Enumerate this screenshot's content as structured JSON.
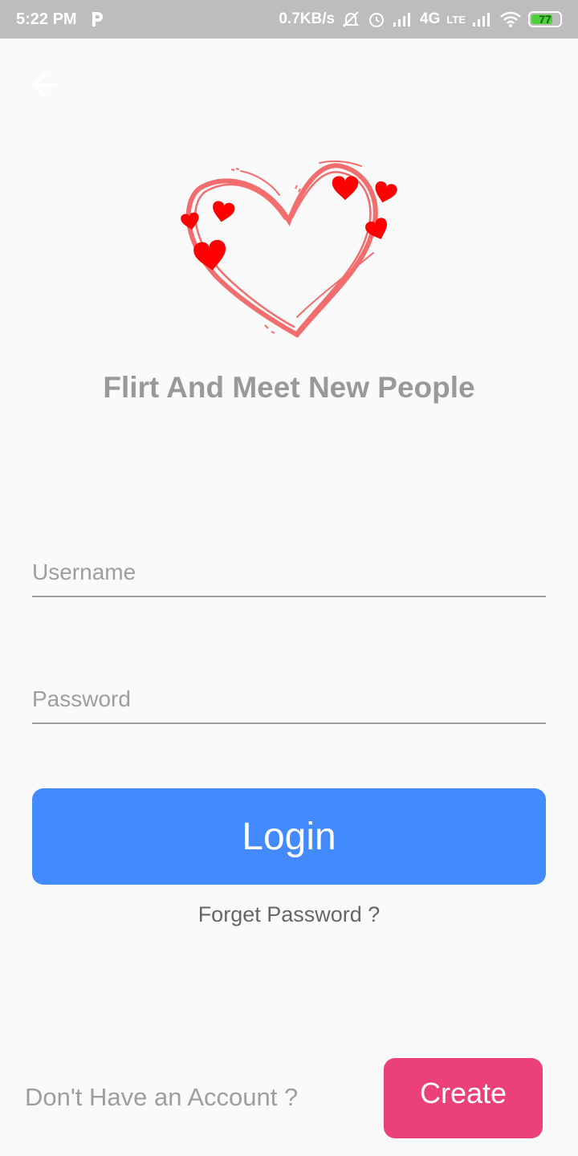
{
  "status_bar": {
    "time": "5:22 PM",
    "carrier_icon": "p-app-icon",
    "speed": "0.7KB/s",
    "network_1": "4G",
    "network_2": "LTE",
    "battery_level": "77",
    "icons": [
      "mute-icon",
      "alarm-icon",
      "signal-icon",
      "wifi-icon",
      "battery-icon"
    ]
  },
  "header": {
    "back_icon": "back-arrow-icon"
  },
  "logo": {
    "icon": "heart-logo-icon",
    "colors": {
      "outline": "#f26d6d",
      "hearts": "#ff0000"
    }
  },
  "tagline": "Flirt And Meet New People",
  "form": {
    "username_placeholder": "Username",
    "password_placeholder": "Password",
    "login_label": "Login",
    "forget_label": "Forget Password ?"
  },
  "footer": {
    "no_account_text": "Don't Have an Account ?",
    "create_label": "Create"
  },
  "colors": {
    "primary": "#448aff",
    "accent": "#ec407a",
    "status_bar": "#bdbdbd",
    "text_muted": "#9e9e9e"
  }
}
